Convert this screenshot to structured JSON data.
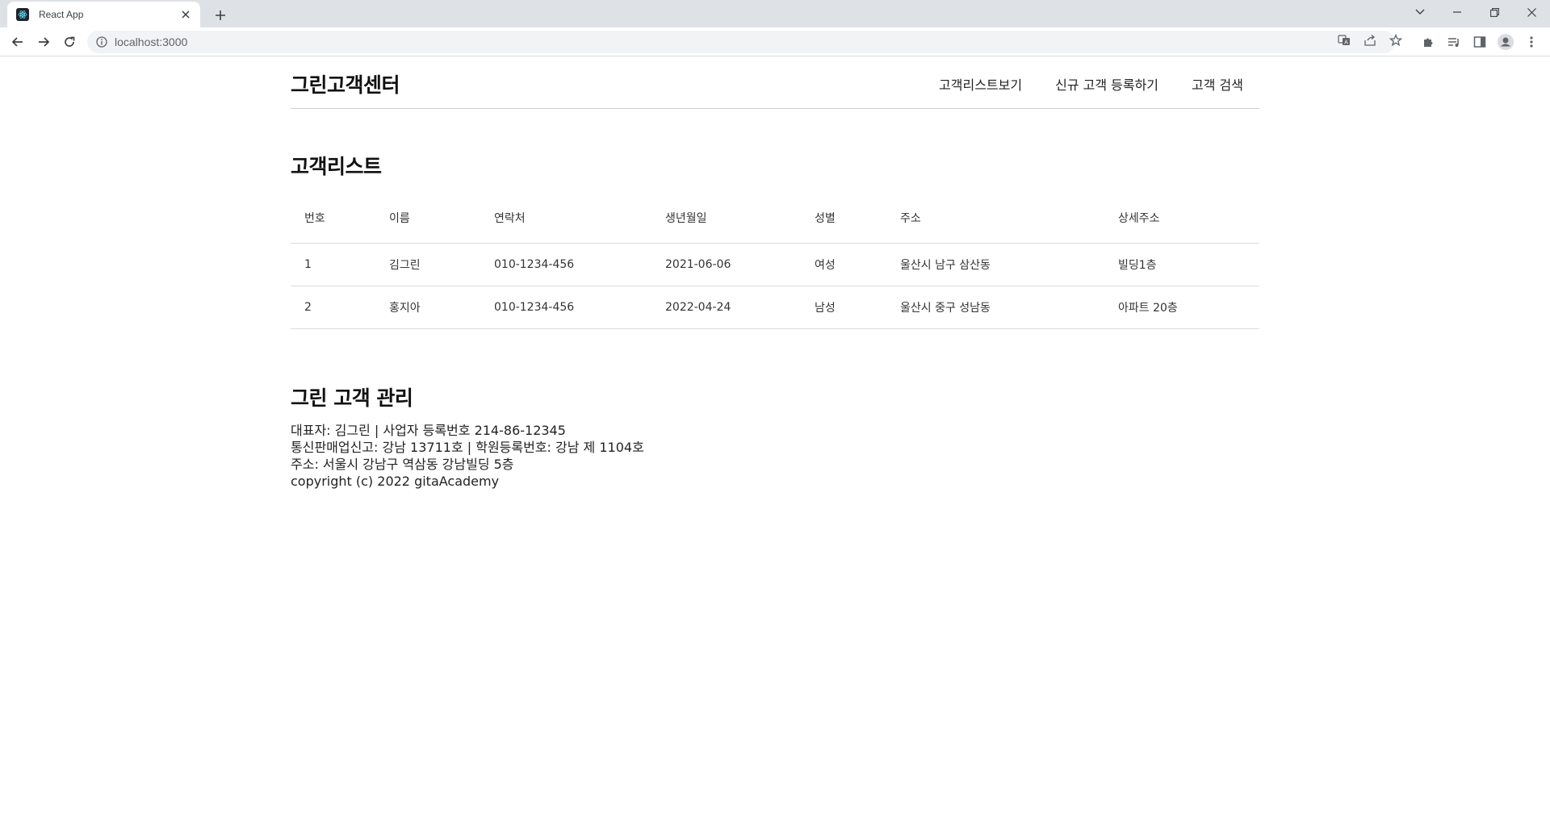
{
  "browser": {
    "tab_title": "React App",
    "url": "localhost:3000"
  },
  "site": {
    "logo": "그린고객센터",
    "nav": [
      {
        "label": "고객리스트보기"
      },
      {
        "label": "신규 고객 등록하기"
      },
      {
        "label": "고객 검색"
      }
    ]
  },
  "customer_list": {
    "title": "고객리스트",
    "columns": [
      "번호",
      "이름",
      "연락처",
      "생년월일",
      "성별",
      "주소",
      "상세주소"
    ],
    "rows": [
      [
        "1",
        "김그린",
        "010-1234-456",
        "2021-06-06",
        "여성",
        "울산시 남구 삼산동",
        "빌딩1층"
      ],
      [
        "2",
        "홍지아",
        "010-1234-456",
        "2022-04-24",
        "남성",
        "울산시 중구 성남동",
        "아파트 20층"
      ]
    ]
  },
  "footer": {
    "title": "그린 고객 관리",
    "lines": [
      "대표자: 김그린 | 사업자 등록번호 214-86-12345",
      "통신판매업신고: 강남 13711호 | 학원등록번호: 강남 제 1104호",
      "주소: 서울시 강남구 역삼동 강남빌딩 5층",
      "copyright (c) 2022 gitaAcademy"
    ]
  },
  "icons": {
    "tab_favicon": "react-logo-icon",
    "tab_close": "close-icon",
    "new_tab": "plus-icon",
    "back": "arrow-left-icon",
    "forward": "arrow-right-icon",
    "reload": "reload-icon",
    "site_info": "info-icon",
    "translate": "translate-icon",
    "share": "share-icon",
    "bookmark": "star-icon",
    "extensions": "puzzle-icon",
    "media": "media-queue-icon",
    "side_panel": "side-panel-icon",
    "profile": "profile-icon",
    "menu": "kebab-menu-icon"
  }
}
